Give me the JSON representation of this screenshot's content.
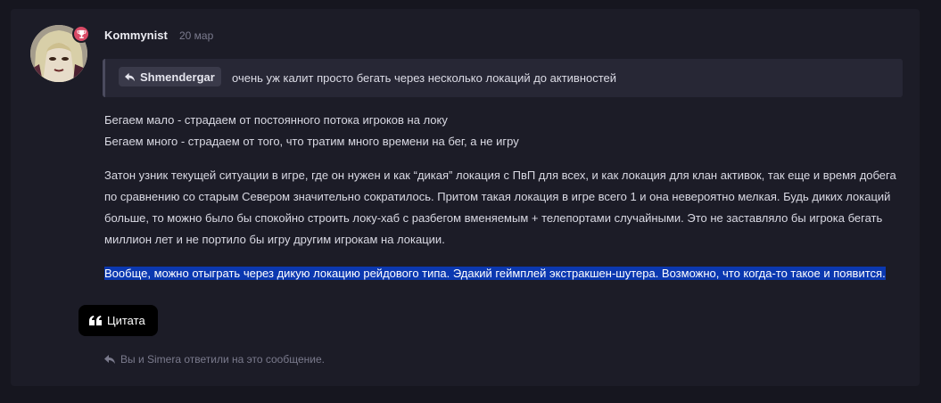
{
  "post": {
    "username": "Kommynist",
    "date": "20 мар",
    "quote": {
      "author": "Shmendergar",
      "text": "очень уж калит просто бегать через несколько локаций до активностей"
    },
    "paragraph1_line1": "Бегаем мало - страдаем от постоянного потока игроков на локу",
    "paragraph1_line2": "Бегаем много - страдаем от того, что тратим много времени на бег, а не игру",
    "paragraph2": "Затон узник текущей ситуации в игре, где он нужен и как “дикая” локация с ПвП для всех, и как локация для клан активок, так еще и время добега по сравнению со старым Севером значительно сократилось. Притом такая локация в игре всего 1 и она невероятно мелкая. Будь диких локаций больше, то можно было бы спокойно строить локу-хаб с разбегом вменяемым + телепортами случайными. Это не заставляло бы игрока бегать миллион лет и не портило бы игру другим игрокам на локации.",
    "paragraph3_selected": "Вообще, можно отыграть через дикую локацию рейдового типа. Эдакий геймплей экстракшен-шутера. Возможно, что когда-то такое и появится.",
    "quote_button_label": "Цитата",
    "replies_text": "Вы и Simera ответили на это сообщение."
  },
  "colors": {
    "background": "#16161f",
    "card": "#1c1c27",
    "selection": "#0b38b0",
    "badge": "#d94a66"
  },
  "icons": {
    "badge": "trophy-icon",
    "quote_author": "reply-arrow-icon",
    "quote_button": "quote-marks-icon",
    "replies": "reply-arrow-icon"
  }
}
